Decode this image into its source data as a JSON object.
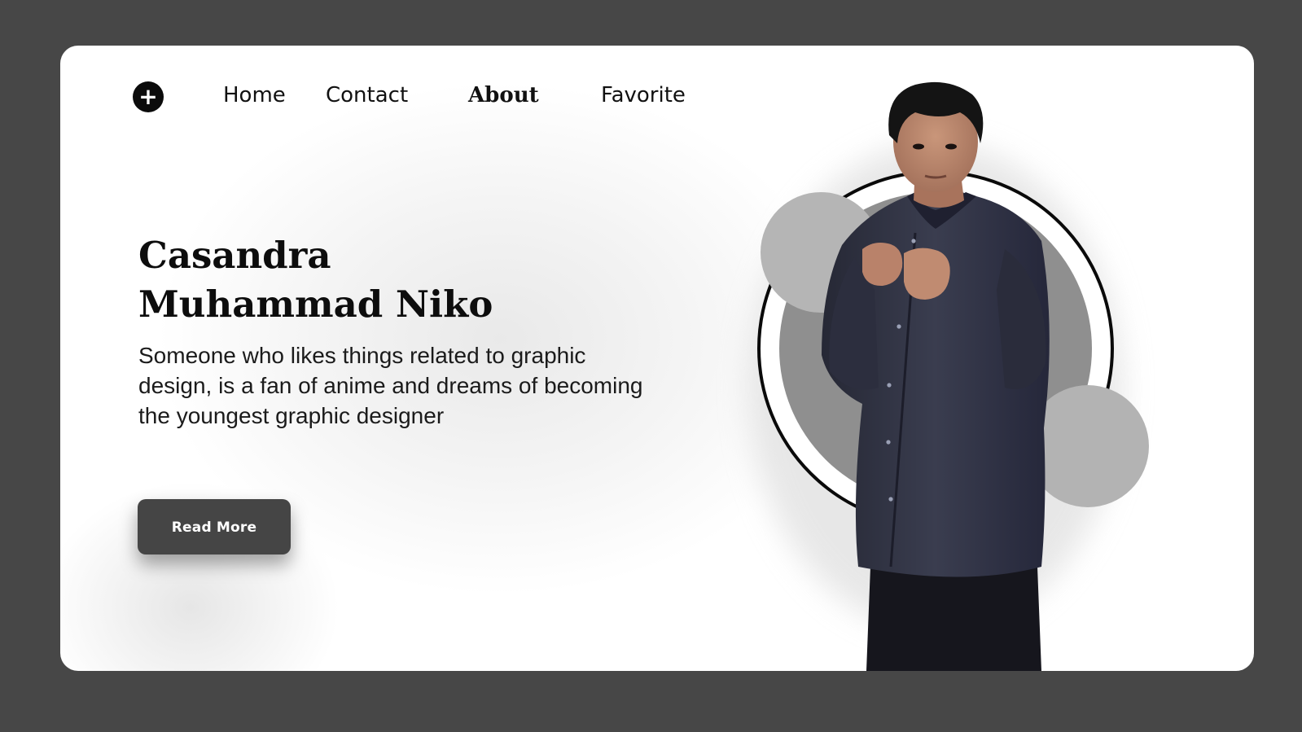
{
  "nav": {
    "logo_icon": "plus-circle-icon",
    "logo_glyph": "+",
    "items": [
      {
        "label": "Home",
        "active": false
      },
      {
        "label": "Contact",
        "active": false
      },
      {
        "label": "About",
        "active": true
      },
      {
        "label": "Favorite",
        "active": false
      }
    ]
  },
  "hero": {
    "name_line1": "Casandra",
    "name_line2": "Muhammad Niko",
    "description": "Someone who likes things related to graphic design, is a fan of anime and dreams of becoming the youngest graphic designer",
    "cta_label": "Read More"
  },
  "colors": {
    "page_background": "#474747",
    "card_background": "#ffffff",
    "button_background": "#454545",
    "circle_gray": "#8f8f8f",
    "circle_light": "#b5b5b5",
    "shirt": "#2f3140"
  }
}
